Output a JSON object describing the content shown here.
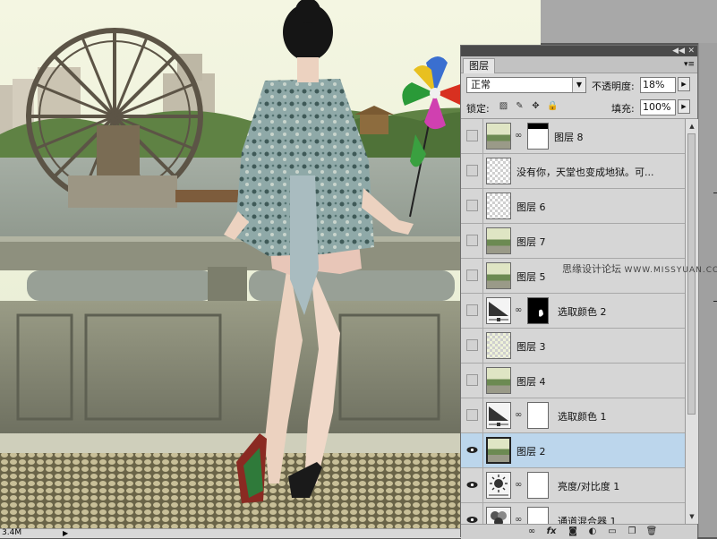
{
  "panel": {
    "tab_label": "图层",
    "blend_mode": "正常",
    "opacity_label": "不透明度:",
    "opacity_value": "18%",
    "lock_label": "锁定:",
    "fill_label": "填充:",
    "fill_value": "100%"
  },
  "layers": [
    {
      "name": "图层 8",
      "visible": false,
      "thumb": "photo",
      "mask": "white-black-top",
      "selected": false
    },
    {
      "name": "没有你，天堂也变成地狱。可...",
      "visible": false,
      "thumb": "checker",
      "mask": "",
      "selected": false
    },
    {
      "name": "图层 6",
      "visible": false,
      "thumb": "checker",
      "mask": "",
      "selected": false
    },
    {
      "name": "图层 7",
      "visible": false,
      "thumb": "photo",
      "mask": "",
      "selected": false
    },
    {
      "name": "图层 5",
      "visible": false,
      "thumb": "photo",
      "mask": "",
      "selected": false
    },
    {
      "name": "选取颜色 2",
      "visible": false,
      "thumb": "adjust",
      "mask": "black",
      "selected": false
    },
    {
      "name": "图层 3",
      "visible": false,
      "thumb": "checker-light",
      "mask": "",
      "selected": false
    },
    {
      "name": "图层 4",
      "visible": false,
      "thumb": "photo",
      "mask": "",
      "selected": false
    },
    {
      "name": "选取颜色 1",
      "visible": false,
      "thumb": "adjust",
      "mask": "white",
      "selected": false
    },
    {
      "name": "图层 2",
      "visible": true,
      "thumb": "photo",
      "mask": "",
      "selected": true
    },
    {
      "name": "亮度/对比度 1",
      "visible": true,
      "thumb": "brightness",
      "mask": "white",
      "selected": false
    },
    {
      "name": "通道混合器 1",
      "visible": true,
      "thumb": "mixer",
      "mask": "white",
      "selected": false
    }
  ],
  "watermark": {
    "cn": "思缘设计论坛",
    "url": "WWW.MISSYUAN.COM"
  },
  "status": {
    "doc_size": "3.4M"
  }
}
